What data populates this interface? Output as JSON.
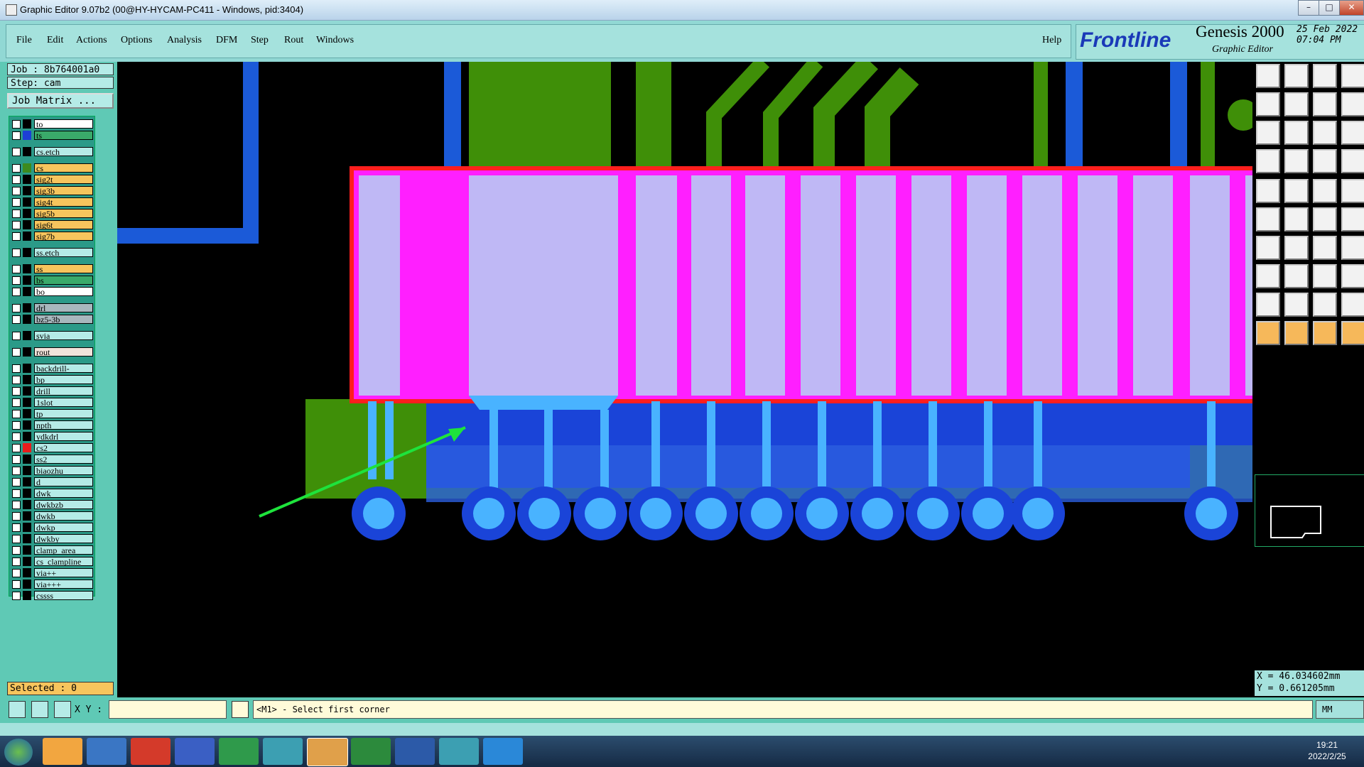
{
  "window": {
    "title": "Graphic Editor 9.07b2 (00@HY-HYCAM-PC411 - Windows, pid:3404)"
  },
  "menu": [
    "File",
    "Edit",
    "Actions",
    "Options",
    "Analysis",
    "DFM",
    "Step",
    "Rout",
    "Windows"
  ],
  "help": "Help",
  "branding": {
    "logo": "Frontline",
    "product": "Genesis 2000",
    "subtitle": "Graphic Editor",
    "date": "25 Feb 2022",
    "time": "07:04 PM"
  },
  "job": {
    "job_label": "Job : 8b764001a0",
    "step_label": "Step: cam",
    "matrix_button": "Job Matrix ..."
  },
  "layers": [
    {
      "name": "to",
      "color": "#ffffff",
      "swatch": "#000000",
      "group": 1
    },
    {
      "name": "ts",
      "color": "#3aaa6a",
      "swatch": "#1d3fd6",
      "group": 1
    },
    {
      "name": "cs.etch",
      "color": "#b5ebe7",
      "swatch": "#000000",
      "group": 2
    },
    {
      "name": "cs",
      "color": "#f7c55d",
      "swatch": "#3d8b1f",
      "group": 3
    },
    {
      "name": "sig2t",
      "color": "#f7c55d",
      "swatch": "#000000",
      "group": 3
    },
    {
      "name": "sig3b",
      "color": "#f7c55d",
      "swatch": "#000000",
      "group": 3
    },
    {
      "name": "sig4t",
      "color": "#f7c55d",
      "swatch": "#000000",
      "group": 3
    },
    {
      "name": "sig5b",
      "color": "#f7c55d",
      "swatch": "#000000",
      "group": 3
    },
    {
      "name": "sig6t",
      "color": "#f7c55d",
      "swatch": "#000000",
      "group": 3
    },
    {
      "name": "sig7b",
      "color": "#f7c55d",
      "swatch": "#000000",
      "group": 3
    },
    {
      "name": "ss.etch",
      "color": "#b5ebe7",
      "swatch": "#000000",
      "group": 4
    },
    {
      "name": "ss",
      "color": "#f7c55d",
      "swatch": "#000000",
      "group": 5
    },
    {
      "name": "bs",
      "color": "#3aaa6a",
      "swatch": "#000000",
      "group": 5
    },
    {
      "name": "bo",
      "color": "#ffffff",
      "swatch": "#000000",
      "group": 5
    },
    {
      "name": "drl",
      "color": "#a8b7bd",
      "swatch": "#000000",
      "group": 6
    },
    {
      "name": "bz5-3b",
      "color": "#a8b7bd",
      "swatch": "#000000",
      "group": 6
    },
    {
      "name": "svia",
      "color": "#b5ebe7",
      "swatch": "#000000",
      "group": 7
    },
    {
      "name": "rout",
      "color": "#f1e3db",
      "swatch": "#000000",
      "group": 8
    },
    {
      "name": "backdrill-",
      "color": "#b5ebe7",
      "swatch": "#000000",
      "group": 9
    },
    {
      "name": "bp",
      "color": "#b5ebe7",
      "swatch": "#000000",
      "group": 9
    },
    {
      "name": "drill",
      "color": "#b5ebe7",
      "swatch": "#000000",
      "group": 9
    },
    {
      "name": "1slot",
      "color": "#b5ebe7",
      "swatch": "#000000",
      "group": 9
    },
    {
      "name": "tp",
      "color": "#b5ebe7",
      "swatch": "#000000",
      "group": 9
    },
    {
      "name": "npth",
      "color": "#b5ebe7",
      "swatch": "#000000",
      "group": 9
    },
    {
      "name": "ydkdrl",
      "color": "#b5ebe7",
      "swatch": "#000000",
      "group": 9
    },
    {
      "name": "cs2",
      "color": "#b5ebe7",
      "swatch": "#e81c1c",
      "group": 9
    },
    {
      "name": "ss2",
      "color": "#b5ebe7",
      "swatch": "#000000",
      "group": 9
    },
    {
      "name": "biaozhu",
      "color": "#b5ebe7",
      "swatch": "#000000",
      "group": 9
    },
    {
      "name": "d",
      "color": "#b5ebe7",
      "swatch": "#000000",
      "group": 9
    },
    {
      "name": "dwk",
      "color": "#b5ebe7",
      "swatch": "#000000",
      "group": 9
    },
    {
      "name": "dwkbzb",
      "color": "#b5ebe7",
      "swatch": "#000000",
      "group": 9
    },
    {
      "name": "dwkb",
      "color": "#b5ebe7",
      "swatch": "#000000",
      "group": 9
    },
    {
      "name": "dwkp",
      "color": "#b5ebe7",
      "swatch": "#000000",
      "group": 9
    },
    {
      "name": "dwkby",
      "color": "#b5ebe7",
      "swatch": "#000000",
      "group": 9
    },
    {
      "name": "clamp_area",
      "color": "#b5ebe7",
      "swatch": "#000000",
      "group": 9
    },
    {
      "name": "cs_clampline",
      "color": "#b5ebe7",
      "swatch": "#000000",
      "group": 9
    },
    {
      "name": "via++",
      "color": "#b5ebe7",
      "swatch": "#000000",
      "group": 9
    },
    {
      "name": "via+++",
      "color": "#b5ebe7",
      "swatch": "#000000",
      "group": 9
    },
    {
      "name": "cssss",
      "color": "#b5ebe7",
      "swatch": "#000000",
      "group": 9
    }
  ],
  "selected": "Selected : 0",
  "coords": {
    "x": "X = 46.034602mm",
    "y": "Y = 0.661205mm"
  },
  "prompt": {
    "xy_label": "X Y :",
    "xy_value": "",
    "message": "<M1> - Select first corner",
    "units": "MM"
  },
  "tray": {
    "time": "19:21",
    "date": "2022/2/25"
  },
  "colors": {
    "pad": "#bfb8f5",
    "mask": "#ff1fff",
    "trace": "#49b3ff",
    "copper_fill": "#0028f0",
    "green_layer": "#3f8f08",
    "outline": "#ff1e1e",
    "arrow": "#1ee33c"
  }
}
